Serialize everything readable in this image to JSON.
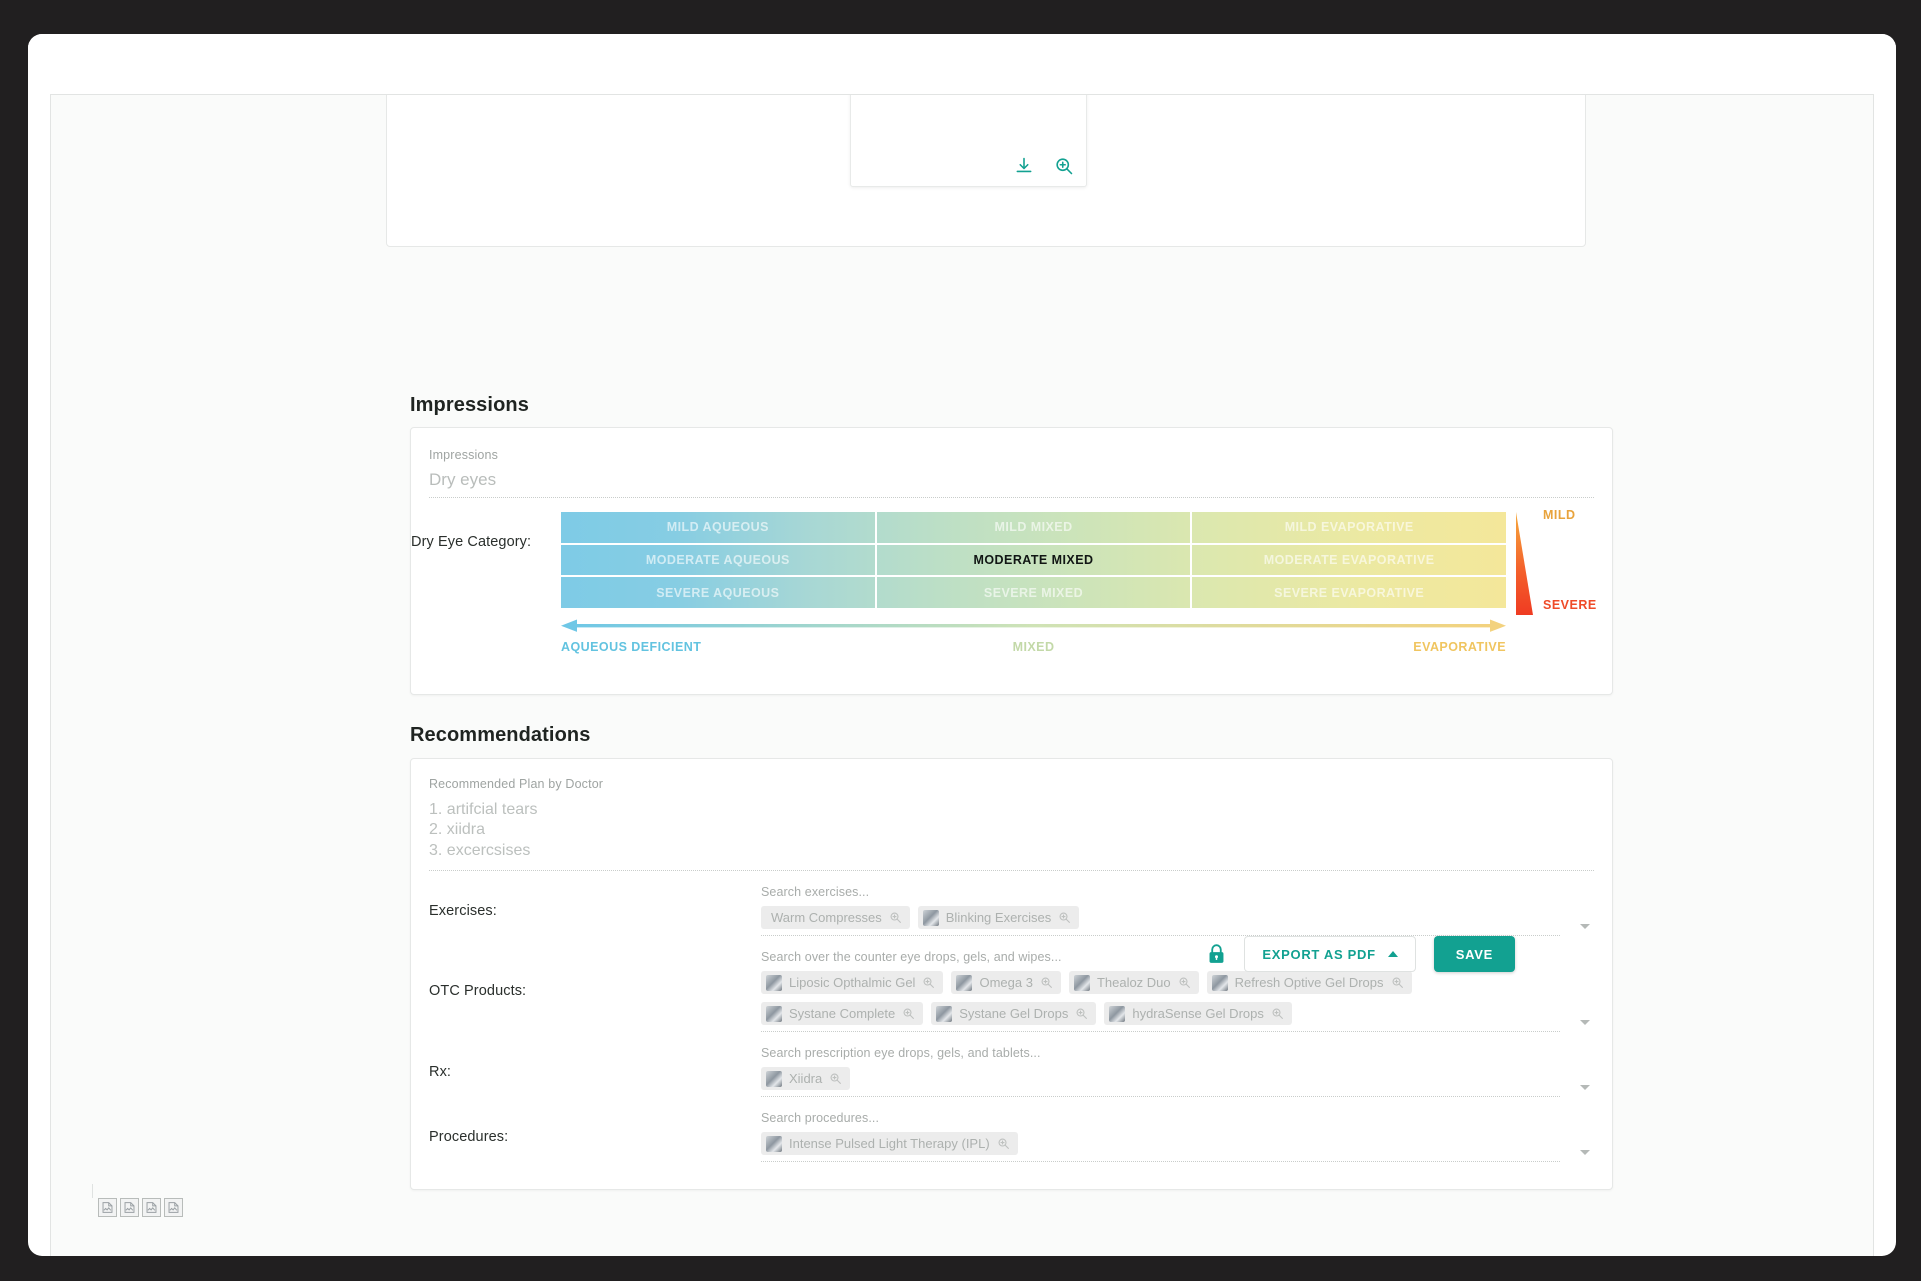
{
  "impressions": {
    "section_title": "Impressions",
    "field_label": "Impressions",
    "field_value": "Dry eyes",
    "dry_eye_category_label": "Dry Eye Category:",
    "grid": {
      "rows": [
        [
          "MILD AQUEOUS",
          "MILD MIXED",
          "MILD EVAPORATIVE"
        ],
        [
          "MODERATE AQUEOUS",
          "MODERATE MIXED",
          "MODERATE EVAPORATIVE"
        ],
        [
          "SEVERE AQUEOUS",
          "SEVERE MIXED",
          "SEVERE EVAPORATIVE"
        ]
      ],
      "selected": "MODERATE MIXED"
    },
    "severity": {
      "mild": "MILD",
      "severe": "SEVERE"
    },
    "axis": {
      "left": "AQUEOUS DEFICIENT",
      "middle": "MIXED",
      "right": "EVAPORATIVE"
    }
  },
  "recommendations": {
    "section_title": "Recommendations",
    "plan_label": "Recommended Plan by Doctor",
    "plan_text": "1. artifcial tears\n2. xiidra\n3. excercsises",
    "rows": [
      {
        "label": "Exercises:",
        "placeholder": "Search exercises...",
        "chips": [
          {
            "label": "Warm Compresses",
            "thumb": false
          },
          {
            "label": "Blinking Exercises",
            "thumb": true
          }
        ]
      },
      {
        "label": "OTC Products:",
        "placeholder": "Search over the counter eye drops, gels, and wipes...",
        "chips": [
          {
            "label": "Liposic Opthalmic Gel",
            "thumb": true
          },
          {
            "label": "Omega 3",
            "thumb": true
          },
          {
            "label": "Thealoz Duo",
            "thumb": true
          },
          {
            "label": "Refresh Optive Gel Drops",
            "thumb": true
          },
          {
            "label": "Systane Complete",
            "thumb": true
          },
          {
            "label": "Systane Gel Drops",
            "thumb": true
          },
          {
            "label": "hydraSense Gel Drops",
            "thumb": true
          }
        ]
      },
      {
        "label": "Rx:",
        "placeholder": "Search prescription eye drops, gels, and tablets...",
        "chips": [
          {
            "label": "Xiidra",
            "thumb": true
          }
        ]
      },
      {
        "label": "Procedures:",
        "placeholder": "Search procedures...",
        "chips": [
          {
            "label": "Intense Pulsed Light Therapy (IPL)",
            "thumb": true
          }
        ]
      }
    ]
  },
  "footer": {
    "export_label": "EXPORT AS PDF",
    "save_label": "SAVE"
  },
  "colors": {
    "accent_teal": "#12a191",
    "mild": "#e8a33c",
    "severe": "#ef4b28",
    "aqueous": "#62c3e0",
    "mixed": "#c3d9a8",
    "evaporative": "#f0c560"
  }
}
